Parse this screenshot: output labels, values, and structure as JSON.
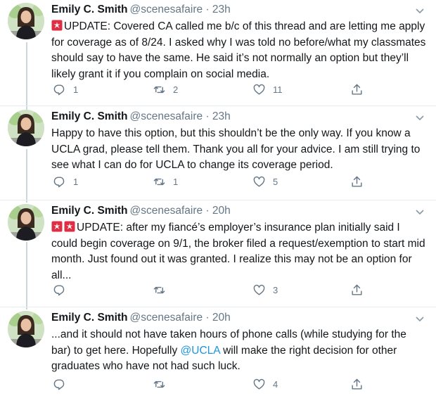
{
  "colors": {
    "text": "#14171a",
    "muted": "#657786",
    "link": "#1b95e0",
    "thread_line": "#ccd6dd",
    "separator": "#e6ecf0"
  },
  "icons": {
    "reply": "reply-icon",
    "retweet": "retweet-icon",
    "like": "like-icon",
    "share": "share-icon",
    "more": "chevron-down-icon",
    "alert": "rotating-light-emoji"
  },
  "tweets": [
    {
      "name": "Emily C. Smith",
      "handle": "@scenesafaire · 23h",
      "emoji_count": 1,
      "text": "UPDATE: Covered CA called me b/c of this thread and are letting me apply for coverage as of 8/24. I asked why I was told no before/what my classmates should say to have the same. He said it’s not normally an option but they’ll likely grant it if you complain on social media.",
      "reply_count": "1",
      "retweet_count": "2",
      "like_count": "11"
    },
    {
      "name": "Emily C. Smith",
      "handle": "@scenesafaire · 23h",
      "emoji_count": 0,
      "text": "Happy to have this option, but this shouldn’t be the only way. If you know a UCLA grad, please tell them. Thank you all for your advice. I am still trying to see what I can do for UCLA to change its coverage period.",
      "reply_count": "1",
      "retweet_count": "1",
      "like_count": "5"
    },
    {
      "name": "Emily C. Smith",
      "handle": "@scenesafaire · 20h",
      "emoji_count": 2,
      "text": "UPDATE: after my fiancé’s employer’s insurance plan initially said I could begin coverage on 9/1, the broker filed a request/exemption to start mid month. Just found out it was granted. I realize this may not be an option for all...",
      "reply_count": "",
      "retweet_count": "",
      "like_count": "3"
    },
    {
      "name": "Emily C. Smith",
      "handle": "@scenesafaire · 20h",
      "emoji_count": 0,
      "text_before": "...and it should not have taken hours of phone calls (while studying for the bar) to get here. Hopefully ",
      "mention": "@UCLA",
      "text_after": " will make the right decision for other graduates who have not had such luck.",
      "reply_count": "",
      "retweet_count": "",
      "like_count": "4"
    }
  ]
}
